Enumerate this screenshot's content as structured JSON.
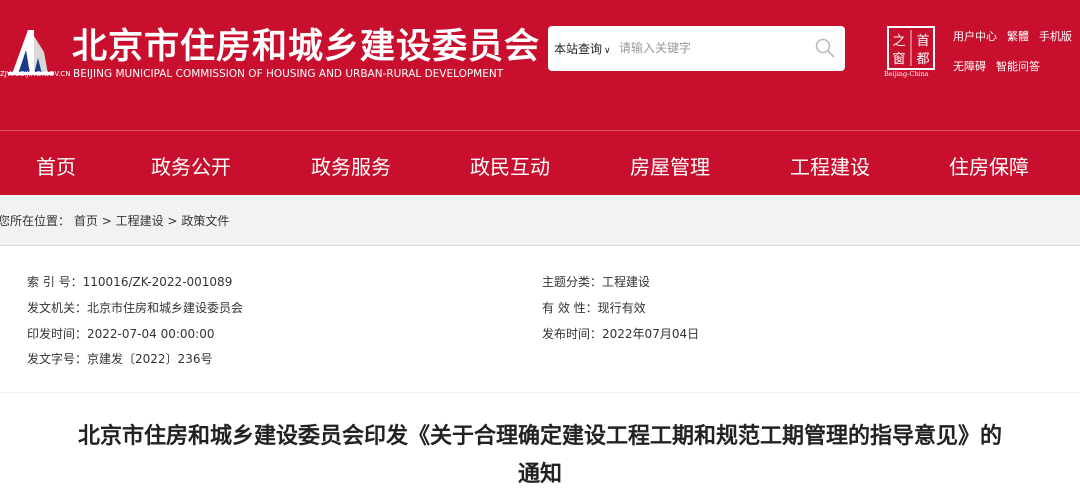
{
  "header": {
    "site_title": "北京市住房和城乡建设委员会",
    "site_subtitle": "BEIJING MUNICIPAL COMMISSION OF HOUSING AND URBAN-RURAL DEVELOPMENT",
    "logo_url_text": "ZJW.BEIJING.GOV.CN",
    "search": {
      "scope_label": "本站查询",
      "placeholder": "请输入关键字"
    },
    "seal": {
      "chars": [
        "首",
        "都",
        "之",
        "窗"
      ],
      "caption": "Beijing-China"
    },
    "links_row1": [
      "用户中心",
      "繁體",
      "手机版"
    ],
    "links_row2": [
      "无障碍",
      "智能问答"
    ]
  },
  "nav": {
    "items": [
      "首页",
      "政务公开",
      "政务服务",
      "政民互动",
      "房屋管理",
      "工程建设",
      "住房保障"
    ]
  },
  "breadcrumb": {
    "prefix": "您所在位置：",
    "items": [
      "首页",
      "工程建设",
      "政策文件"
    ],
    "separator": ">"
  },
  "meta": {
    "index_label": "索 引 号：",
    "index_value": "110016/ZK-2022-001089",
    "issuer_label": "发文机关：",
    "issuer_value": "北京市住房和城乡建设委员会",
    "date_label": "印发时间：",
    "date_value": "2022-07-04 00:00:00",
    "docno_label": "发文字号：",
    "docno_value": "京建发〔2022〕236号",
    "topic_label": "主题分类：",
    "topic_value": "工程建设",
    "validity_label": "有 效 性：",
    "validity_value": "现行有效",
    "publish_label": "发布时间：",
    "publish_value": "2022年07月04日"
  },
  "document": {
    "title_line1": "北京市住房和城乡建设委员会印发《关于合理确定建设工程工期和规范工期管理的指导意见》的",
    "title_line2": "通知"
  },
  "colors": {
    "brand_red": "#c8102e",
    "breadcrumb_bg": "#f2f2f2"
  }
}
